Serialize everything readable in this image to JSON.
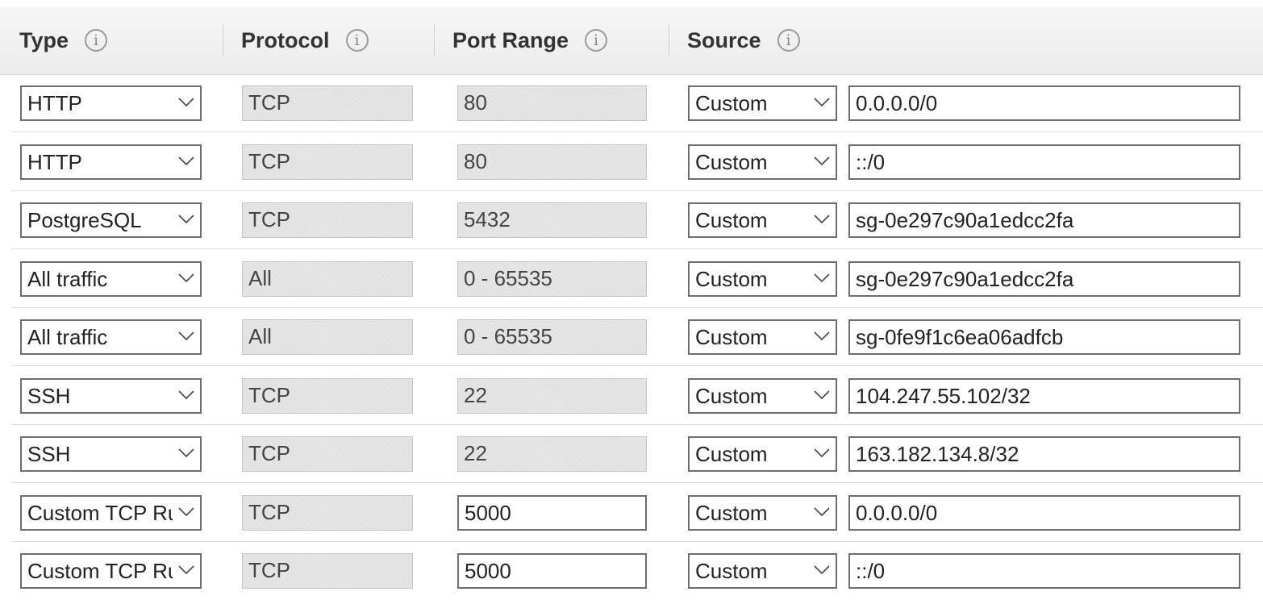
{
  "header": {
    "type_label": "Type",
    "protocol_label": "Protocol",
    "port_range_label": "Port Range",
    "source_label": "Source",
    "info_glyph": "i"
  },
  "rules": [
    {
      "type": "HTTP",
      "protocol": "TCP",
      "port_range": "80",
      "port_editable": false,
      "source_mode": "Custom",
      "source": "0.0.0.0/0"
    },
    {
      "type": "HTTP",
      "protocol": "TCP",
      "port_range": "80",
      "port_editable": false,
      "source_mode": "Custom",
      "source": "::/0"
    },
    {
      "type": "PostgreSQL",
      "protocol": "TCP",
      "port_range": "5432",
      "port_editable": false,
      "source_mode": "Custom",
      "source": "sg-0e297c90a1edcc2fa"
    },
    {
      "type": "All traffic",
      "protocol": "All",
      "port_range": "0 - 65535",
      "port_editable": false,
      "source_mode": "Custom",
      "source": "sg-0e297c90a1edcc2fa"
    },
    {
      "type": "All traffic",
      "protocol": "All",
      "port_range": "0 - 65535",
      "port_editable": false,
      "source_mode": "Custom",
      "source": "sg-0fe9f1c6ea06adfcb"
    },
    {
      "type": "SSH",
      "protocol": "TCP",
      "port_range": "22",
      "port_editable": false,
      "source_mode": "Custom",
      "source": "104.247.55.102/32"
    },
    {
      "type": "SSH",
      "protocol": "TCP",
      "port_range": "22",
      "port_editable": false,
      "source_mode": "Custom",
      "source": "163.182.134.8/32"
    },
    {
      "type": "Custom TCP Rule",
      "protocol": "TCP",
      "port_range": "5000",
      "port_editable": true,
      "source_mode": "Custom",
      "source": "0.0.0.0/0"
    },
    {
      "type": "Custom TCP Rule",
      "protocol": "TCP",
      "port_range": "5000",
      "port_editable": true,
      "source_mode": "Custom",
      "source": "::/0"
    }
  ],
  "icons": {
    "info": "info-icon",
    "dropdown": "chevron-down-icon"
  },
  "colors": {
    "header_bg": "#efefef",
    "readonly_bg": "#e6e6e6",
    "input_border": "#6e6e6e"
  }
}
